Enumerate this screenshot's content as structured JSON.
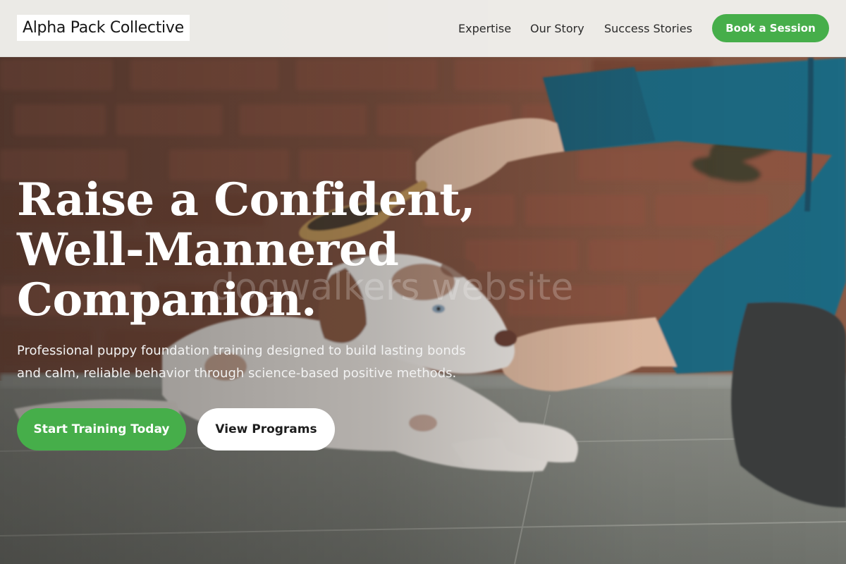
{
  "header": {
    "logo": "Alpha Pack Collective",
    "nav": [
      "Expertise",
      "Our Story",
      "Success Stories"
    ],
    "cta_label": "Book a Session"
  },
  "hero": {
    "headline_lines": [
      "Raise a Confident,",
      "Well-Mannered",
      "Companion."
    ],
    "subtitle_lines": [
      "Professional puppy foundation training designed to build lasting bonds",
      "and calm, reliable behavior through science-based positive methods."
    ],
    "watermark": "dogwalkers website",
    "primary_button": "Start Training Today",
    "secondary_button": "View Programs",
    "image_description_icon": "puppy-brushing-photo"
  },
  "colors": {
    "accent_green": "#46ae4a",
    "header_bg": "#f1f1ee",
    "text_white": "#ffffff"
  }
}
